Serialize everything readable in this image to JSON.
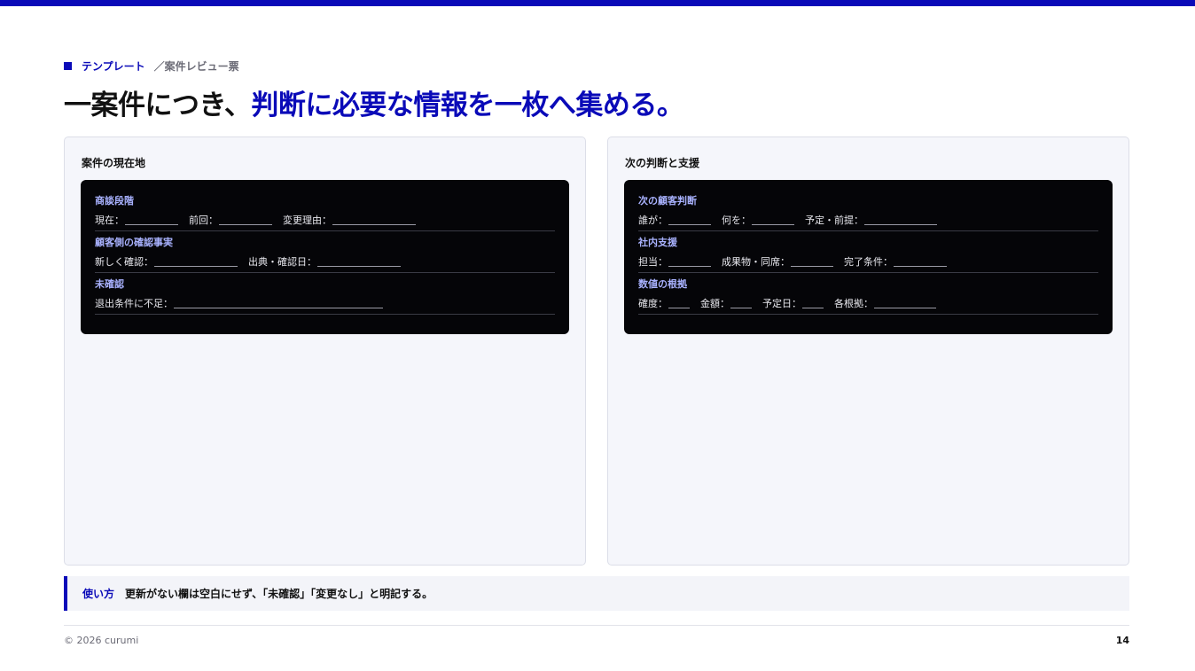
{
  "breadcrumb": {
    "category": "テンプレート",
    "current": "／案件レビュー票"
  },
  "title": {
    "lead": "一案件につき、",
    "highlight": "判断に必要な情報を一枚へ集める。"
  },
  "left_panel": {
    "title": "案件の現在地",
    "sections": [
      {
        "label": "商談段階",
        "fields": [
          "現在：",
          "前回：",
          "変更理由："
        ]
      },
      {
        "label": "顧客側の確認事実",
        "fields": [
          "新しく確認：",
          "出典・確認日："
        ]
      },
      {
        "label": "未確認",
        "fields": [
          "退出条件に不足："
        ]
      }
    ]
  },
  "right_panel": {
    "title": "次の判断と支援",
    "sections": [
      {
        "label": "次の顧客判断",
        "fields": [
          "誰が：",
          "何を：",
          "予定・前提："
        ]
      },
      {
        "label": "社内支援",
        "fields": [
          "担当：",
          "成果物・同席：",
          "完了条件："
        ]
      },
      {
        "label": "数値の根拠",
        "fields": [
          "確度：",
          "金額：",
          "予定日：",
          "各根拠："
        ]
      }
    ]
  },
  "usage": {
    "label": "使い方",
    "text": "更新がない欄は空白にせず、「未確認」「変更なし」と明記する。"
  },
  "footer": {
    "copyright": "© 2026 curumi",
    "page": "14"
  },
  "colors": {
    "accent": "#0a0ab8",
    "panel_bg": "#f5f6fb",
    "dark_box": "#050508",
    "section_label": "#a9b2ff"
  }
}
